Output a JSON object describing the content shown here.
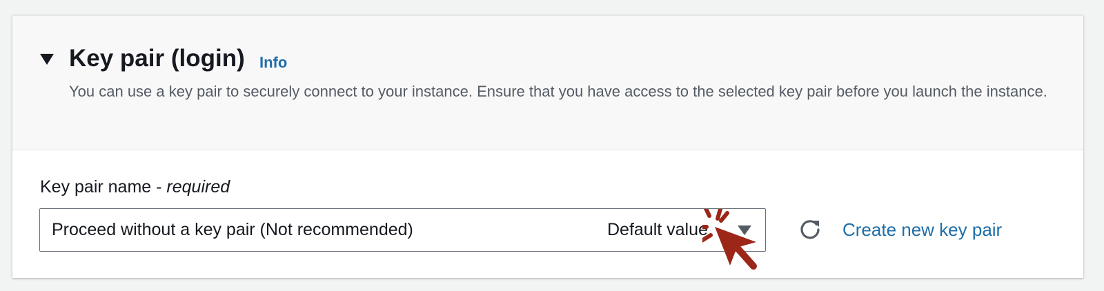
{
  "section": {
    "title": "Key pair (login)",
    "info_link": "Info",
    "description": "You can use a key pair to securely connect to your instance. Ensure that you have access to the selected key pair before you launch the instance.",
    "expanded": true
  },
  "key_pair_field": {
    "label": "Key pair name - ",
    "label_required": "required",
    "selected_value": "Proceed without a key pair (Not recommended)",
    "default_tag": "Default value",
    "refresh_icon": "refresh-icon",
    "create_link": "Create new key pair"
  },
  "colors": {
    "link": "#1f6ea8",
    "text": "#16191f",
    "secondary_text": "#545b64",
    "click_marker": "#9c2718"
  }
}
